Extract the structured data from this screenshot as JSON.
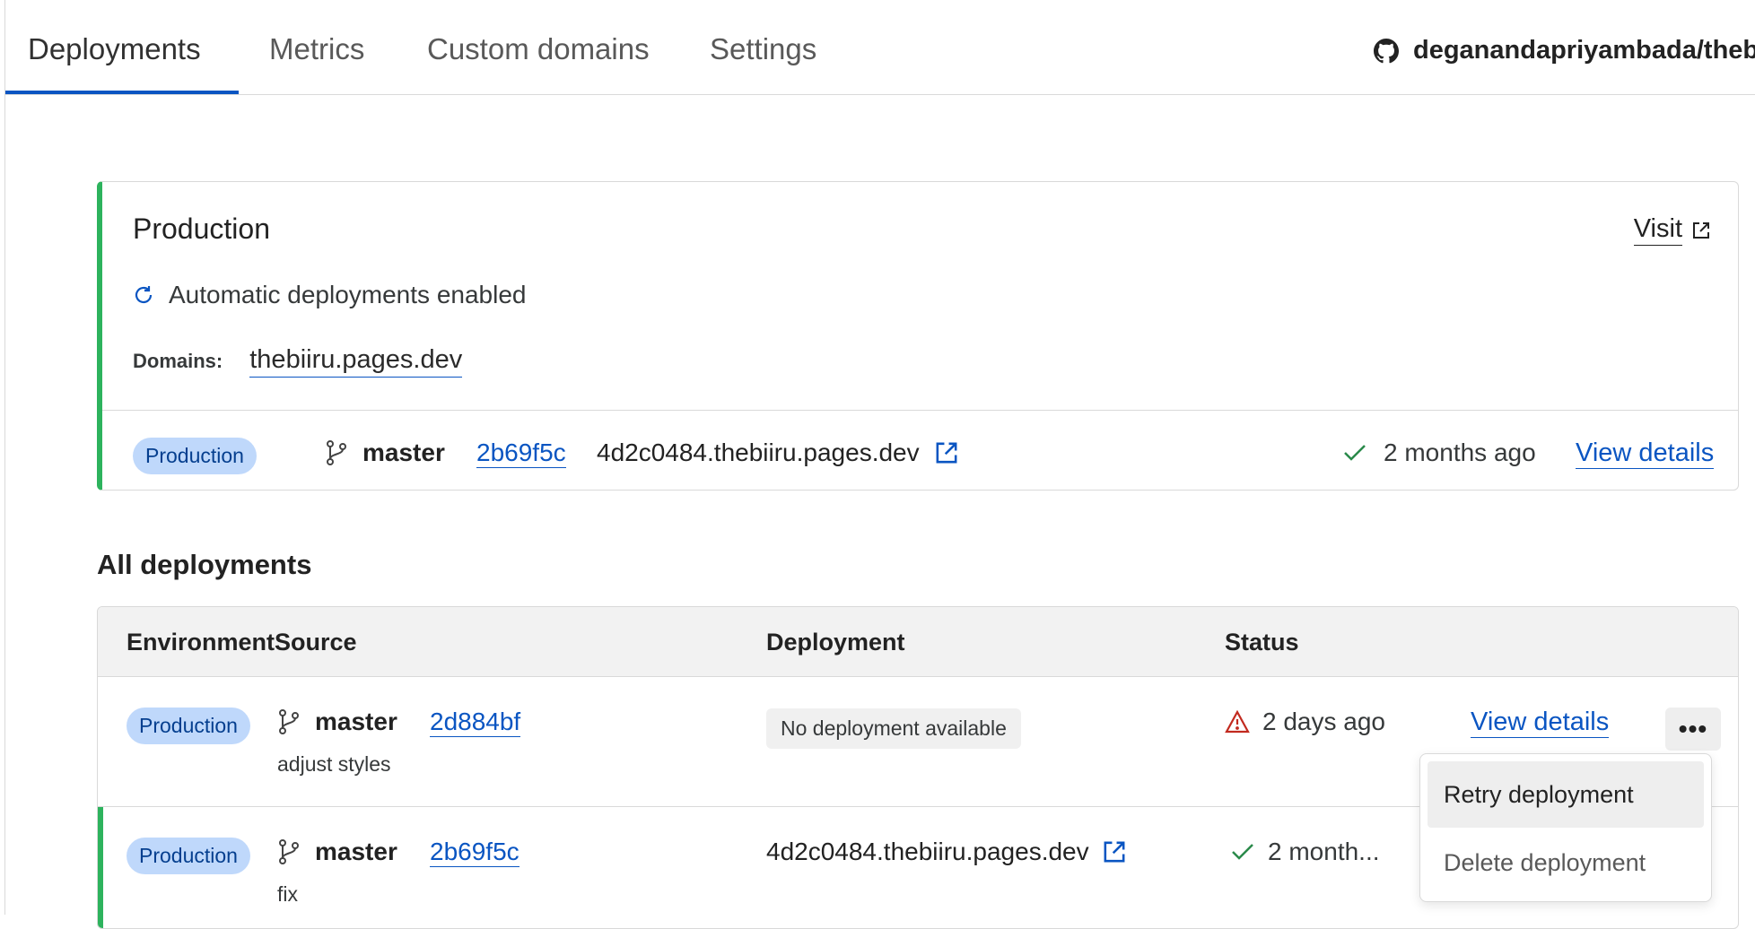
{
  "tabs": [
    {
      "label": "Deployments",
      "active": true
    },
    {
      "label": "Metrics"
    },
    {
      "label": "Custom domains"
    },
    {
      "label": "Settings"
    }
  ],
  "repo": {
    "icon": "github-icon",
    "name": "deganandapriyambada/thebiir"
  },
  "production": {
    "title": "Production",
    "visit_label": "Visit",
    "auto_deploy_text": "Automatic deployments enabled",
    "domains_label": "Domains:",
    "domain": "thebiiru.pages.dev",
    "latest": {
      "environment": "Production",
      "branch": "master",
      "commit": "2b69f5c",
      "url": "4d2c0484.thebiiru.pages.dev",
      "status": "2 months ago",
      "view_details": "View details"
    }
  },
  "all_deployments": {
    "title": "All deployments",
    "columns": [
      "EnvironmentSource",
      "Deployment",
      "Status"
    ],
    "rows": [
      {
        "environment": "Production",
        "branch": "master",
        "commit": "2d884bf",
        "message": "adjust styles",
        "deployment": "No deployment available",
        "status_icon": "warning-icon",
        "status": "2 days ago",
        "view_details": "View details"
      },
      {
        "environment": "Production",
        "branch": "master",
        "commit": "2b69f5c",
        "message": "fix",
        "deployment": "4d2c0484.thebiiru.pages.dev",
        "status_icon": "check-icon",
        "status": "2 month..."
      }
    ]
  },
  "context_menu": {
    "items": [
      "Retry deployment",
      "Delete deployment"
    ]
  },
  "colors": {
    "accent": "#0a55c2",
    "success": "#2db35d",
    "danger": "#c22a1f",
    "badge_bg": "#bfd8fb"
  }
}
